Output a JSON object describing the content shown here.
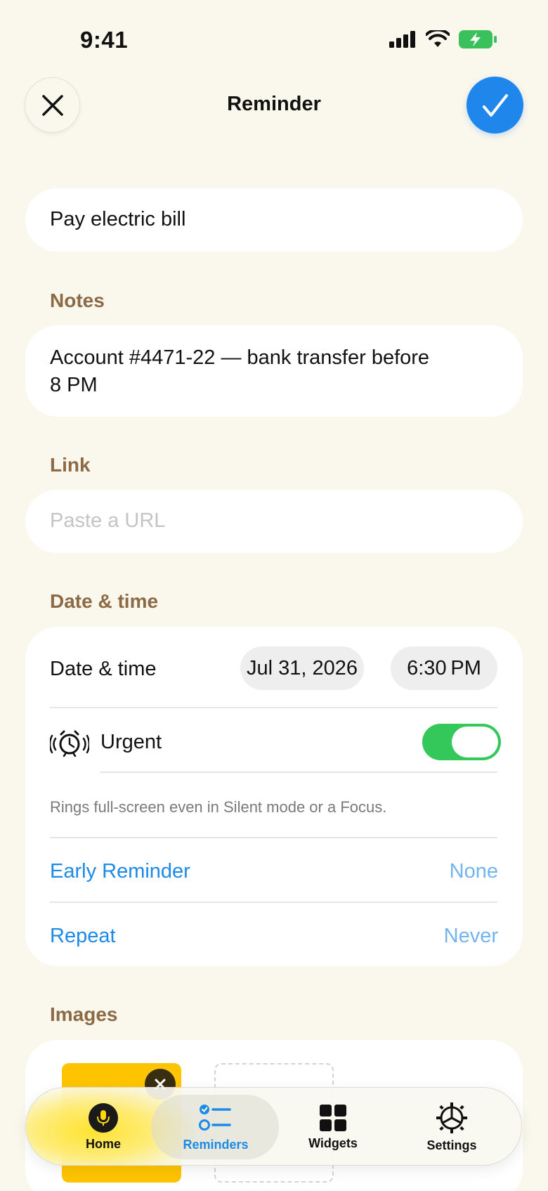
{
  "status": {
    "time": "9:41"
  },
  "header": {
    "title": "Reminder"
  },
  "title_field": {
    "value": "Pay electric bill"
  },
  "notes": {
    "label": "Notes",
    "line1": "Account #4471-22 — bank transfer before",
    "line2": "8 PM"
  },
  "link": {
    "label": "Link",
    "placeholder": "Paste a URL"
  },
  "date_section": {
    "label": "Date & time",
    "row_label": "Date & time",
    "date": "Jul 31, 2026",
    "time": "6:30 PM",
    "urgent_label": "Urgent",
    "urgent_on": true,
    "urgent_note": "Rings full-screen even in Silent mode or a Focus.",
    "early_label": "Early Reminder",
    "early_value": "None",
    "repeat_label": "Repeat",
    "repeat_value": "Never"
  },
  "images": {
    "label": "Images"
  },
  "tabs": [
    {
      "label": "Home",
      "icon": "microphone-icon"
    },
    {
      "label": "Reminders",
      "icon": "checklist-icon",
      "selected": true
    },
    {
      "label": "Widgets",
      "icon": "grid-icon"
    },
    {
      "label": "Settings",
      "icon": "gear-icon"
    }
  ],
  "colors": {
    "accent": "#1f87ec",
    "section_label": "#8c6a45",
    "toggle_on": "#34c759",
    "background": "#faf7ec"
  }
}
